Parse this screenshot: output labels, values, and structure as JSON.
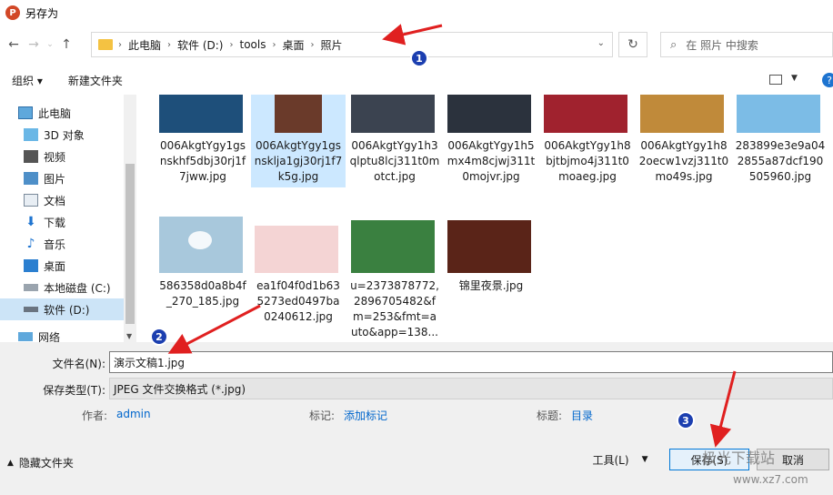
{
  "window": {
    "title": "另存为",
    "app_icon_letter": "P"
  },
  "nav": {
    "breadcrumbs": [
      "此电脑",
      "软件 (D:)",
      "tools",
      "桌面",
      "照片"
    ],
    "search_placeholder": "在 照片 中搜索"
  },
  "toolbar": {
    "organize": "组织 ▾",
    "new_folder": "新建文件夹"
  },
  "sidebar": {
    "items": [
      {
        "label": "此电脑",
        "icon": "computer-icon"
      },
      {
        "label": "3D 对象",
        "icon": "cube-icon"
      },
      {
        "label": "视频",
        "icon": "video-icon"
      },
      {
        "label": "图片",
        "icon": "picture-icon"
      },
      {
        "label": "文档",
        "icon": "document-icon"
      },
      {
        "label": "下载",
        "icon": "download-icon"
      },
      {
        "label": "音乐",
        "icon": "music-icon"
      },
      {
        "label": "桌面",
        "icon": "desktop-icon"
      },
      {
        "label": "本地磁盘 (C:)",
        "icon": "drive-icon"
      },
      {
        "label": "软件 (D:)",
        "icon": "drive-icon"
      },
      {
        "label": "网络",
        "icon": "network-icon"
      }
    ]
  },
  "files": [
    {
      "name": "006AkgtYgy1gsnskhf5dbj30rj1f7jww.jpg",
      "lines": [
        "006AkgtYgy1gs",
        "nskhf5dbj30rj1f",
        "7jww.jpg"
      ],
      "color": "#3a6fa0"
    },
    {
      "name": "006AkgtYgy1gsnsklja1gj30rj1f7k5g.jpg",
      "lines": [
        "006AkgtYgy1gs",
        "nsklja1gj30rj1f7",
        "k5g.jpg"
      ],
      "color": "#6a4030"
    },
    {
      "name": "006AkgtYgy1h3qlptu8lcj311t0motct.jpg",
      "lines": [
        "006AkgtYgy1h3",
        "qlptu8lcj311t0m",
        "otct.jpg"
      ],
      "color": "#38404c"
    },
    {
      "name": "006AkgtYgy1h5mx4m8cjwj311t0mojvr.jpg",
      "lines": [
        "006AkgtYgy1h5",
        "mx4m8cjwj311t",
        "0mojvr.jpg"
      ],
      "color": "#2c3440"
    },
    {
      "name": "006AkgtYgy1h8bjtbjmo4j311t0moaeg.jpg",
      "lines": [
        "006AkgtYgy1h8",
        "bjtbjmo4j311t0",
        "moaeg.jpg"
      ],
      "color": "#a02030"
    },
    {
      "name": "006AkgtYgy1h82oecw1vzj311t0mo49s.jpg",
      "lines": [
        "006AkgtYgy1h8",
        "2oecw1vzj311t0",
        "mo49s.jpg"
      ],
      "color": "#c08030"
    },
    {
      "name": "283899e3e9a042855a87dcf190505960.jpg",
      "lines": [
        "283899e3e9a04",
        "2855a87dcf190",
        "505960.jpg"
      ],
      "color": "#6cb0e0"
    },
    {
      "name": "586358d0a8b4f_270_185.jpg",
      "lines": [
        "586358d0a8b4f",
        "_270_185.jpg"
      ],
      "color": "#a8c8dc"
    },
    {
      "name": "ea1f04f0d1b635273ed0497ba0240612.jpg",
      "lines": [
        "ea1f04f0d1b63",
        "5273ed0497ba",
        "0240612.jpg"
      ],
      "color": "#f0c0c0"
    },
    {
      "name": "u=2373878772,2896705482&fm=253&fmt=auto&app=138...",
      "lines": [
        "u=2373878772,",
        "2896705482&f",
        "m=253&fmt=a",
        "uto&app=138..."
      ],
      "color": "#3a8040"
    },
    {
      "name": "锦里夜景.jpg",
      "lines": [
        "锦里夜景.jpg"
      ],
      "color": "#5a2418"
    }
  ],
  "form": {
    "filename_label": "文件名(N):",
    "filename_value": "演示文稿1.jpg",
    "filetype_label": "保存类型(T):",
    "filetype_value": "JPEG 文件交换格式 (*.jpg)",
    "author_label": "作者:",
    "author_value": "admin",
    "tags_label": "标记:",
    "tags_value": "添加标记",
    "title_label": "标题:",
    "title_value": "目录",
    "hide_folders": "隐藏文件夹",
    "tools": "工具(L)",
    "save": "保存(S)",
    "cancel": "取消"
  },
  "annotations": {
    "badge1": "1",
    "badge2": "2",
    "badge3": "3"
  },
  "watermark": {
    "brand": "极光下载站",
    "url": "www.xz7.com"
  }
}
